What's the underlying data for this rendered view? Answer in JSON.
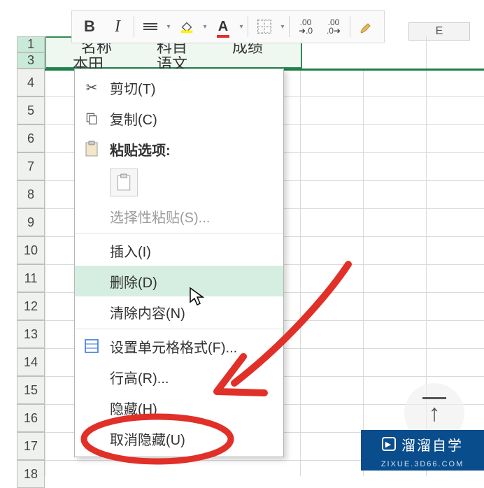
{
  "toolbar": {
    "bold": "B",
    "italic": "I",
    "font_letter": "A",
    "inc_dec_left_top": ".00",
    "inc_dec_left_bot": "➜.0",
    "inc_dec_right_top": ".00",
    "inc_dec_right_bot": ".0➜"
  },
  "col_headers": {
    "E": "E"
  },
  "row_headers": [
    "1",
    "3",
    "4",
    "5",
    "6",
    "7",
    "8",
    "9",
    "10",
    "11",
    "12",
    "13",
    "14",
    "15",
    "16",
    "17",
    "18"
  ],
  "cells": {
    "b1": "名称",
    "c1": "科目",
    "d1": "成绩",
    "b3": "本田",
    "c3": "语文"
  },
  "context_menu": {
    "cut": "剪切(T)",
    "copy": "复制(C)",
    "paste_options": "粘贴选项:",
    "paste_special": "选择性粘贴(S)...",
    "insert": "插入(I)",
    "delete": "删除(D)",
    "clear": "清除内容(N)",
    "format_cells": "设置单元格格式(F)...",
    "row_height": "行高(R)...",
    "hide": "隐藏(H)",
    "unhide": "取消隐藏(U)"
  },
  "watermark": {
    "brand": "溜溜自学",
    "sub": "ZIXUE.3D66.COM"
  }
}
